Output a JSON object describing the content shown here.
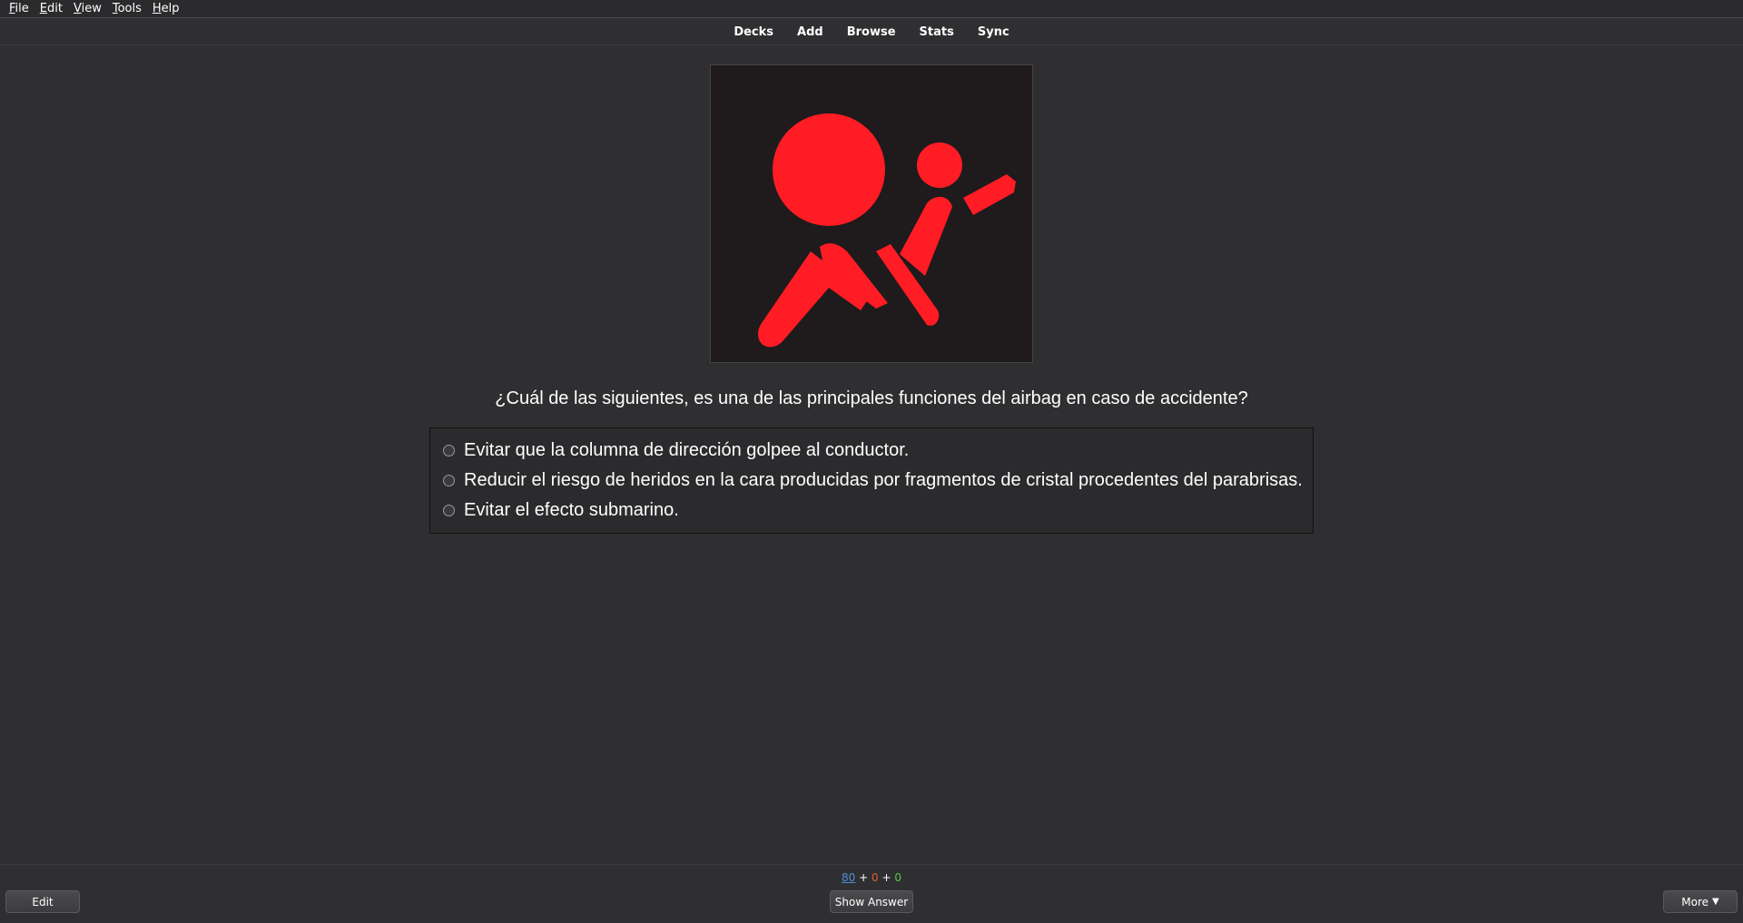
{
  "menu": {
    "items": [
      {
        "mnemonic": "F",
        "rest": "ile"
      },
      {
        "mnemonic": "E",
        "rest": "dit"
      },
      {
        "mnemonic": "V",
        "rest": "iew"
      },
      {
        "mnemonic": "T",
        "rest": "ools"
      },
      {
        "mnemonic": "H",
        "rest": "elp"
      }
    ]
  },
  "toolbar": {
    "decks": "Decks",
    "add": "Add",
    "browse": "Browse",
    "stats": "Stats",
    "sync": "Sync"
  },
  "card": {
    "image_icon": "airbag-warning-icon",
    "icon_color": "#ff1c24",
    "question": "¿Cuál de las siguientes, es una de las principales funciones del airbag en caso de accidente?",
    "options": [
      "Evitar que la columna de dirección golpee al conductor.",
      "Reducir el riesgo de heridos en la cara producidas por fragmentos de cristal procedentes del parabrisas.",
      "Evitar el efecto submarino."
    ]
  },
  "bottom": {
    "counts": {
      "new": "80",
      "sep1": " + ",
      "learn": "0",
      "sep2": " + ",
      "review": "0"
    },
    "edit_label": "Edit",
    "show_answer_label": "Show Answer",
    "more_label": "More",
    "more_caret": "▼"
  }
}
